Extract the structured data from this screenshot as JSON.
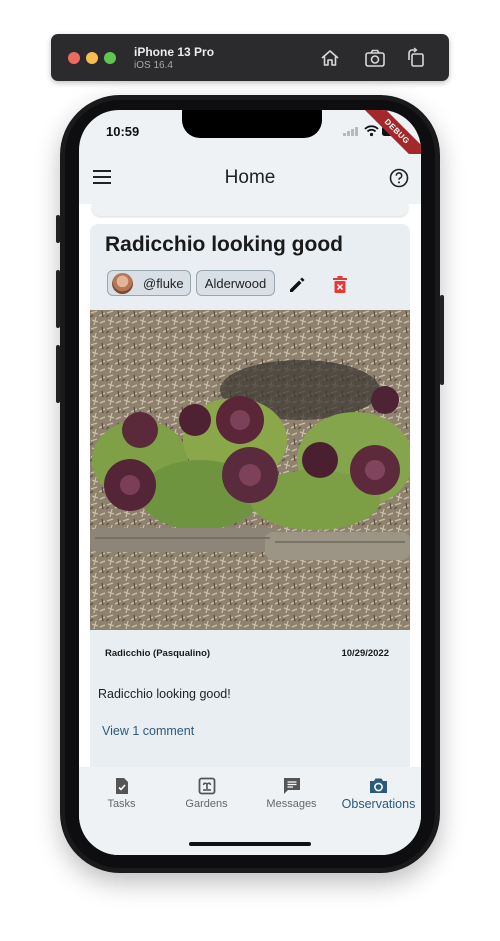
{
  "simulator": {
    "device": "iPhone 13 Pro",
    "os": "iOS 16.4",
    "icons": [
      "home-icon",
      "screenshot-icon",
      "rotate-icon"
    ]
  },
  "status_bar": {
    "time": "10:59",
    "debug_banner": "DEBUG"
  },
  "app_bar": {
    "title": "Home",
    "left_icon": "menu-icon",
    "right_icon": "help-icon"
  },
  "observation": {
    "title": "Radicchio looking good",
    "user_chip": "@fluke",
    "garden_chip": "Alderwood",
    "plant": "Radicchio  (Pasqualino)",
    "date": "10/29/2022",
    "description": "Radicchio looking good!",
    "comments_link": "View 1 comment",
    "actions": [
      "edit-icon",
      "delete-icon"
    ]
  },
  "bottom_nav": {
    "items": [
      {
        "label": "Tasks",
        "icon": "tasks-icon",
        "active": false
      },
      {
        "label": "Gardens",
        "icon": "gardens-icon",
        "active": false
      },
      {
        "label": "Messages",
        "icon": "messages-icon",
        "active": false
      },
      {
        "label": "Observations",
        "icon": "camera-icon",
        "active": true
      }
    ]
  },
  "colors": {
    "accent": "#2a5a7c",
    "delete": "#e53935",
    "card_background": "#e9eef2",
    "debug_ribbon": "#a3282c"
  }
}
